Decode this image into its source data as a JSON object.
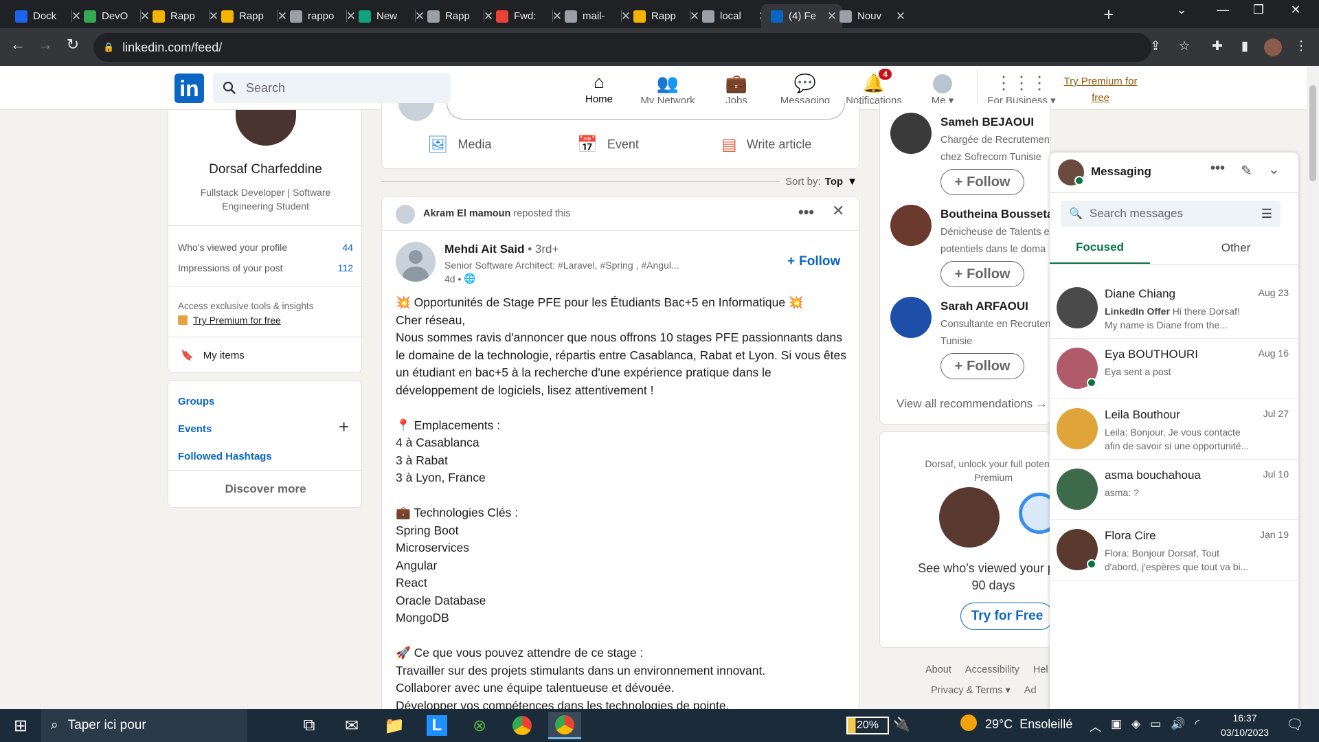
{
  "browser": {
    "tabs": [
      {
        "label": "Dock",
        "color": "#1d63ed"
      },
      {
        "label": "DevO",
        "color": "#34a853"
      },
      {
        "label": "Rapp",
        "color": "#f4b400"
      },
      {
        "label": "Rapp",
        "color": "#f4b400"
      },
      {
        "label": "rappo",
        "color": "#9aa0a6"
      },
      {
        "label": "New",
        "color": "#10a37f"
      },
      {
        "label": "Rapp",
        "color": "#9aa0a6"
      },
      {
        "label": "Fwd:",
        "color": "#ea4335"
      },
      {
        "label": "mail-",
        "color": "#9aa0a6"
      },
      {
        "label": "Rapp",
        "color": "#f4b400"
      },
      {
        "label": "local",
        "color": "#9aa0a6"
      },
      {
        "label": "(4) Fe",
        "color": "#0a66c2"
      },
      {
        "label": "Nouv",
        "color": "#9aa0a6"
      }
    ],
    "active_tab_index": 11,
    "url": "linkedin.com/feed/"
  },
  "header": {
    "logo": "in",
    "search_placeholder": "Search",
    "nav": [
      {
        "label": "Home",
        "icon": "home-icon"
      },
      {
        "label": "My Network",
        "icon": "network-icon"
      },
      {
        "label": "Jobs",
        "icon": "briefcase-icon"
      },
      {
        "label": "Messaging",
        "icon": "chat-icon"
      },
      {
        "label": "Notifications",
        "icon": "bell-icon",
        "badge": "4"
      },
      {
        "label": "Me",
        "icon": "avatar-icon"
      },
      {
        "label": "For Business",
        "icon": "grid-icon"
      }
    ],
    "premium_line1": "Try Premium for",
    "premium_line2": "free"
  },
  "profile": {
    "name": "Dorsaf Charfeddine",
    "headline_line1": "Fullstack Developer | Software",
    "headline_line2": "Engineering Student",
    "stats": [
      {
        "label": "Who's viewed your profile",
        "value": "44"
      },
      {
        "label": "Impressions of your post",
        "value": "112"
      }
    ],
    "premium_caption": "Access exclusive tools & insights",
    "premium_link": "Try Premium for free",
    "my_items": "My items"
  },
  "left_links": {
    "groups": "Groups",
    "events": "Events",
    "hashtags": "Followed Hashtags",
    "discover": "Discover more"
  },
  "share_box": {
    "media": "Media",
    "event": "Event",
    "article": "Write article"
  },
  "sort": {
    "label": "Sort by:",
    "value": "Top"
  },
  "post": {
    "reposter": "Akram El mamoun",
    "reposted_text": "reposted this",
    "author": "Mehdi Ait Said",
    "degree": "• 3rd+",
    "author_headline": "Senior Software Architect: #Laravel, #Spring , #Angul...",
    "time": "4d •",
    "follow": "Follow",
    "lines": [
      "💥 Opportunités de Stage PFE pour les Étudiants Bac+5 en Informatique 💥",
      "Cher réseau,",
      "Nous sommes ravis d'annoncer que nous offrons 10 stages PFE passionnants dans",
      "le domaine de la technologie, répartis entre Casablanca, Rabat et Lyon. Si vous êtes",
      "un étudiant en bac+5 à la recherche d'une expérience pratique dans le",
      "développement de logiciels, lisez attentivement !",
      "",
      "📍 Emplacements :",
      "4 à Casablanca",
      "3 à Rabat",
      "3 à Lyon, France",
      "",
      "💼 Technologies Clés :",
      "Spring Boot",
      "Microservices",
      "Angular",
      "React",
      "Oracle Database",
      "MongoDB",
      "",
      "🚀 Ce que vous pouvez attendre de ce stage :",
      "Travailler sur des projets stimulants dans un environnement innovant.",
      "Collaborer avec une équipe talentueuse et dévouée.",
      "Développer vos compétences dans les technologies de pointe."
    ]
  },
  "recommendations": {
    "people": [
      {
        "name": "Sameh BEJAOUI",
        "line1": "Chargée de Recrutement et Intégration",
        "line2": "chez Sofrecom Tunisie"
      },
      {
        "name": "Boutheina Bousseta",
        "line1": "Dénicheuse de Talents e",
        "line2": "potentiels dans le doma"
      },
      {
        "name": "Sarah ARFAOUI",
        "line1": "Consultante en Recruten",
        "line2": "Tunisie"
      }
    ],
    "follow": "Follow",
    "view_all": "View all recommendations"
  },
  "premium_ad": {
    "line1": "Dorsaf, unlock your full potential",
    "line2": "Premium",
    "cta_line1": "See who's viewed your prof",
    "cta_line2": "90 days",
    "button": "Try for Free"
  },
  "footer": {
    "row1": [
      "About",
      "Accessibility",
      "Hel"
    ],
    "row2": [
      "Privacy & Terms",
      "Ad"
    ]
  },
  "messaging": {
    "title": "Messaging",
    "search_placeholder": "Search messages",
    "tabs": [
      "Focused",
      "Other"
    ],
    "conversations": [
      {
        "name": "Diane Chiang",
        "date": "Aug 23",
        "tag": "LinkedIn Offer",
        "preview1": "Hi there Dorsaf!",
        "preview2": "My name is Diane from the...",
        "color": "#4a4a4a"
      },
      {
        "name": "Eya BOUTHOURI",
        "date": "Aug 16",
        "tag": "",
        "preview1": "Eya sent a post",
        "preview2": "",
        "color": "#b05a6a"
      },
      {
        "name": "Leila Bouthour",
        "date": "Jul 27",
        "tag": "",
        "preview1": "Leila: Bonjour, Je vous contacte",
        "preview2": "afin de savoir si une opportunité...",
        "color": "#e0a53a"
      },
      {
        "name": "asma bouchahoua",
        "date": "Jul 10",
        "tag": "",
        "preview1": "asma: ?",
        "preview2": "",
        "color": "#3d6b4a"
      },
      {
        "name": "Flora Cire",
        "date": "Jan 19",
        "tag": "",
        "preview1": "Flora: Bonjour Dorsaf, Tout",
        "preview2": "d'abord, j'espères que tout va bi...",
        "color": "#5a3a2e"
      }
    ]
  },
  "taskbar": {
    "search_text": "Taper ici pour",
    "battery": "20%",
    "weather_temp": "29°C",
    "weather_desc": "Ensoleillé",
    "time": "16:37",
    "date": "03/10/2023"
  }
}
